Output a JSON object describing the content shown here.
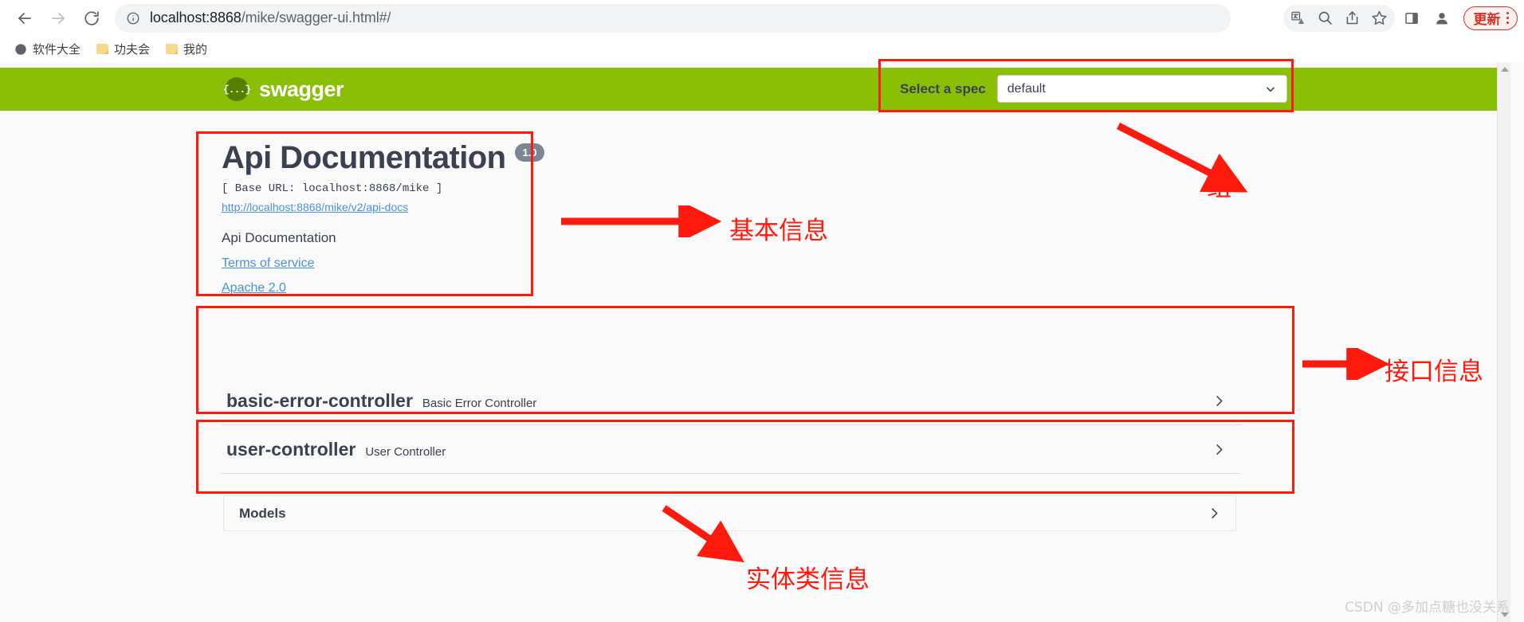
{
  "browser": {
    "back_icon": "arrow-left-icon",
    "forward_icon": "arrow-right-icon",
    "reload_icon": "reload-icon",
    "site_info_icon": "info-circle-icon",
    "url_host": "localhost:8868",
    "url_path": "/mike/swagger-ui.html#/",
    "url_full": "localhost:8868/mike/swagger-ui.html#/",
    "toolbar_icons": [
      "translate-icon",
      "zoom-out-icon",
      "share-icon",
      "bookmark-star-icon",
      "side-panel-icon",
      "profile-avatar-icon"
    ],
    "update_button_label": "更新",
    "menu_icon": "three-dots-vertical-icon",
    "bookmarks": [
      {
        "label": "软件大全",
        "icon": "globe-icon"
      },
      {
        "label": "功夫会",
        "icon": "folder-icon"
      },
      {
        "label": "我的",
        "icon": "folder-icon"
      }
    ]
  },
  "swagger": {
    "logo_text": "swagger",
    "logo_glyph": "{...}",
    "spec_label": "Select a spec",
    "spec_selected": "default",
    "spec_chevron_icon": "chevron-down-icon",
    "info": {
      "title": "Api Documentation",
      "version": "1.0",
      "base_url": "[ Base URL: localhost:8868/mike ]",
      "api_docs_url": "http://localhost:8868/mike/v2/api-docs",
      "description": "Api Documentation",
      "terms_of_service": "Terms of service",
      "license": "Apache 2.0"
    },
    "tags": [
      {
        "name": "basic-error-controller",
        "description": "Basic Error Controller",
        "expand_icon": "chevron-right-icon"
      },
      {
        "name": "user-controller",
        "description": "User Controller",
        "expand_icon": "chevron-right-icon"
      }
    ],
    "models": {
      "title": "Models",
      "expand_icon": "chevron-right-icon"
    }
  },
  "annotations": {
    "colors": {
      "highlight": "#ff1a0d",
      "swagger_green": "#89bf04",
      "update_red": "#d93025"
    },
    "labels": [
      {
        "id": "group",
        "text": "组"
      },
      {
        "id": "basic_info",
        "text": "基本信息"
      },
      {
        "id": "api_info",
        "text": "接口信息"
      },
      {
        "id": "entity_info",
        "text": "实体类信息"
      }
    ]
  },
  "watermark": {
    "text": "CSDN @多加点糖也没关系"
  }
}
